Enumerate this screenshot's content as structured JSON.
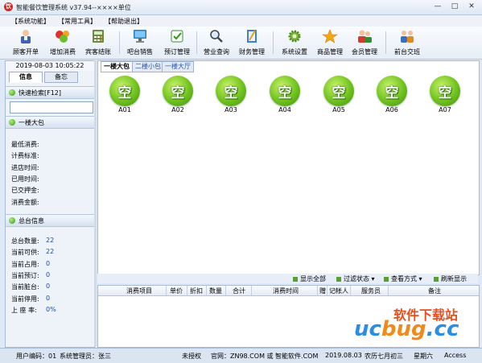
{
  "window": {
    "title": "智能餐饮管理系统 v37.94--××××单位",
    "app_icon_glyph": "饮"
  },
  "menu": [
    "【系统功能】",
    "【常用工具】",
    "【帮助退出】"
  ],
  "toolbar": [
    {
      "label": "顾客开单",
      "icon": "waiter-icon"
    },
    {
      "label": "增加消费",
      "icon": "fruit-icon"
    },
    {
      "label": "宾客结账",
      "icon": "calculator-icon"
    },
    {
      "label": "吧台销售",
      "icon": "monitor-icon"
    },
    {
      "label": "预订管理",
      "icon": "booking-icon"
    },
    {
      "label": "营业查询",
      "icon": "magnifier-icon"
    },
    {
      "label": "财务管理",
      "icon": "notebook-icon"
    },
    {
      "label": "系统设置",
      "icon": "gear-icon"
    },
    {
      "label": "商品管理",
      "icon": "star-icon"
    },
    {
      "label": "会员管理",
      "icon": "members-icon"
    },
    {
      "label": "前台交班",
      "icon": "handover-icon"
    }
  ],
  "left_panel": {
    "datetime": "2019-08-03  10:05:22",
    "tabs": [
      "信息",
      "备忘"
    ],
    "search_title": "快速检索[F12]",
    "search_value": "",
    "table_section_title": "一楼大包",
    "table_fields": [
      "最低消费:",
      "计费标准:",
      "进店时间:",
      "已用时间:",
      "已交押金:",
      "消费金额:"
    ],
    "summary_title": "总台信息",
    "summary": [
      {
        "label": "总台数量:",
        "value": "22"
      },
      {
        "label": "当前可供:",
        "value": "22"
      },
      {
        "label": "当前占用:",
        "value": "0"
      },
      {
        "label": "当前预订:",
        "value": "0"
      },
      {
        "label": "当前脏台:",
        "value": "0"
      },
      {
        "label": "当前停用:",
        "value": "0"
      },
      {
        "label": "上 座 率:",
        "value": "0%"
      }
    ]
  },
  "main": {
    "tabs": [
      "一楼大包",
      "二楼小包",
      "一楼大厅"
    ],
    "table_status_glyph": "空",
    "tables": [
      "A01",
      "A02",
      "A03",
      "A04",
      "A05",
      "A06",
      "A07"
    ]
  },
  "filter_bar": [
    "显示全部",
    "过滤状态 ▾",
    "查看方式 ▾",
    "刷新显示"
  ],
  "order_grid": {
    "columns": [
      "消费项目",
      "单价",
      "折扣",
      "数量",
      "合计",
      "消费时间",
      "赠",
      "记帐人",
      "服务员",
      "备注"
    ]
  },
  "status_bar": {
    "user_code": "用户编码：01",
    "operator": "系统管理员：张三",
    "license": "未授权",
    "website": "官网：ZN98.COM 或 智能软件.COM",
    "date": "2019.08.03",
    "lunar": "农历七月初三",
    "weekday": "星期六",
    "db": "Access"
  },
  "watermark": {
    "top": "软件下载站",
    "logo_a": "uc",
    "logo_b": "bug",
    "logo_c": ".cc"
  }
}
